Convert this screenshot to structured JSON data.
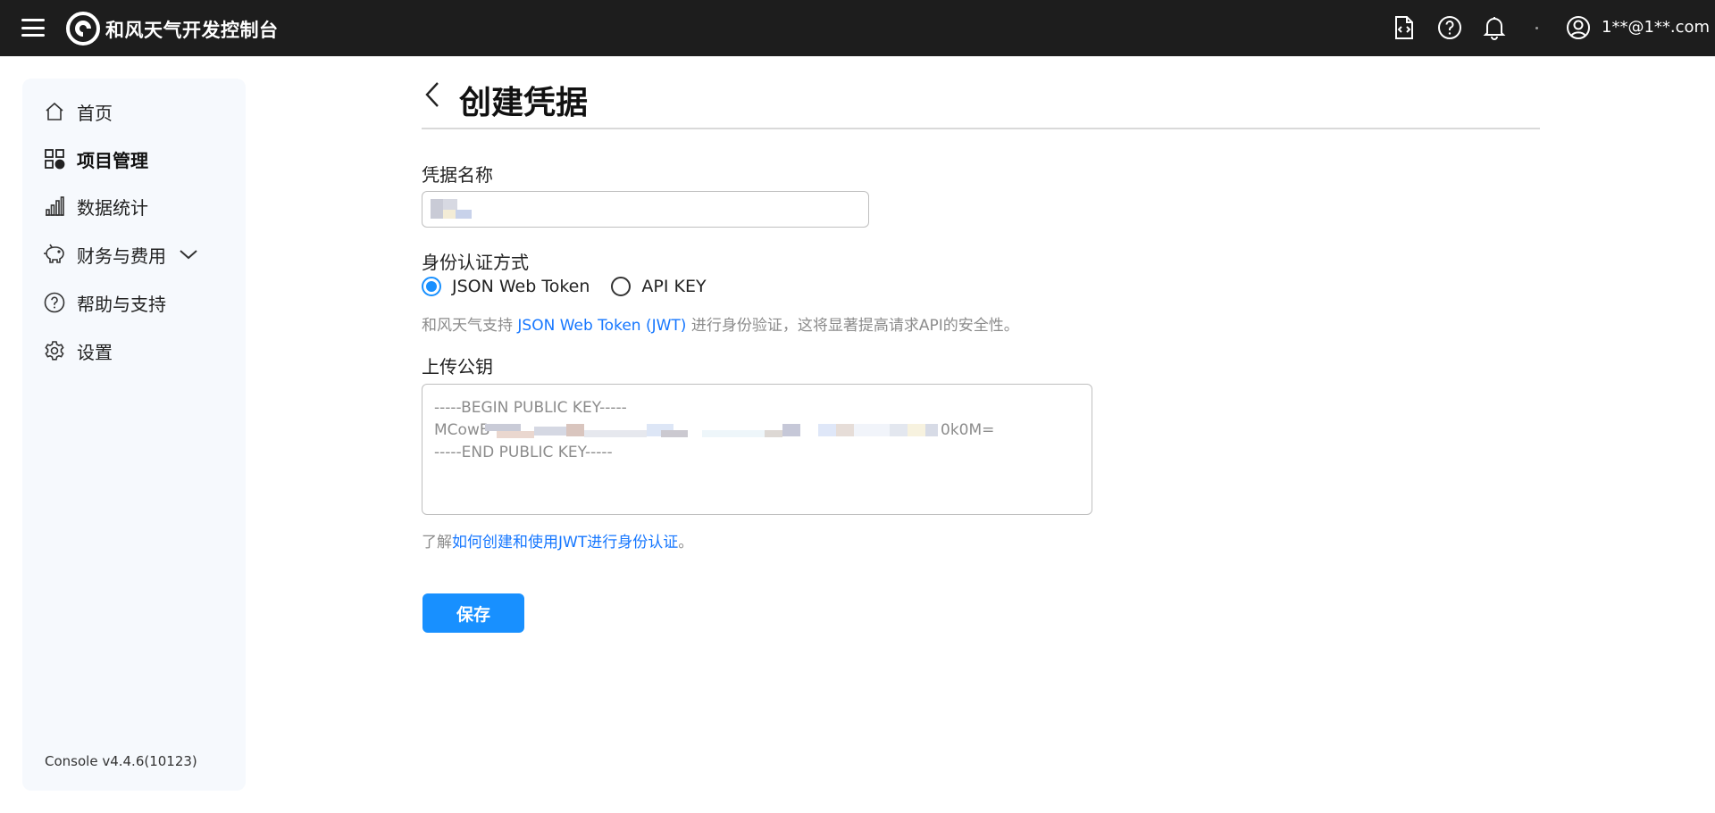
{
  "header": {
    "brand": "和风天气开发控制台",
    "user_email": "1**@1**.com",
    "icons": [
      "menu-icon",
      "file-code-icon",
      "help-circle-icon",
      "bell-icon",
      "user-circle-icon"
    ]
  },
  "sidebar": {
    "items": [
      {
        "label": "首页",
        "icon": "home-icon",
        "active": false
      },
      {
        "label": "项目管理",
        "icon": "grid-icon",
        "active": true
      },
      {
        "label": "数据统计",
        "icon": "bar-chart-icon",
        "active": false
      },
      {
        "label": "财务与费用",
        "icon": "piggy-bank-icon",
        "active": false,
        "expandable": true
      },
      {
        "label": "帮助与支持",
        "icon": "help-circle-icon",
        "active": false
      },
      {
        "label": "设置",
        "icon": "gear-icon",
        "active": false
      }
    ],
    "version": "Console v4.4.6(10123)"
  },
  "main": {
    "title": "创建凭据",
    "credential_name_label": "凭据名称",
    "credential_name_value": "",
    "auth_method_label": "身份认证方式",
    "auth_options": [
      {
        "label": "JSON Web Token",
        "selected": true
      },
      {
        "label": "API KEY",
        "selected": false
      }
    ],
    "help_prefix": "和风天气支持 ",
    "help_link": "JSON Web Token (JWT)",
    "help_suffix": " 进行身份验证，这将显著提高请求API的安全性。",
    "public_key_label": "上传公钥",
    "public_key_line1": "-----BEGIN PUBLIC KEY-----",
    "public_key_line2_start": "MCowB",
    "public_key_line2_end": "0k0M=",
    "public_key_line3": "-----END PUBLIC KEY-----",
    "learn_prefix": "了解",
    "learn_link": "如何创建和使用JWT进行身份认证",
    "learn_suffix": "。",
    "save_label": "保存"
  },
  "colors": {
    "topbar": "#1d1d1d",
    "accent": "#1890ff",
    "link": "#1677ff",
    "sidebar_bg": "#f6f9fd"
  }
}
